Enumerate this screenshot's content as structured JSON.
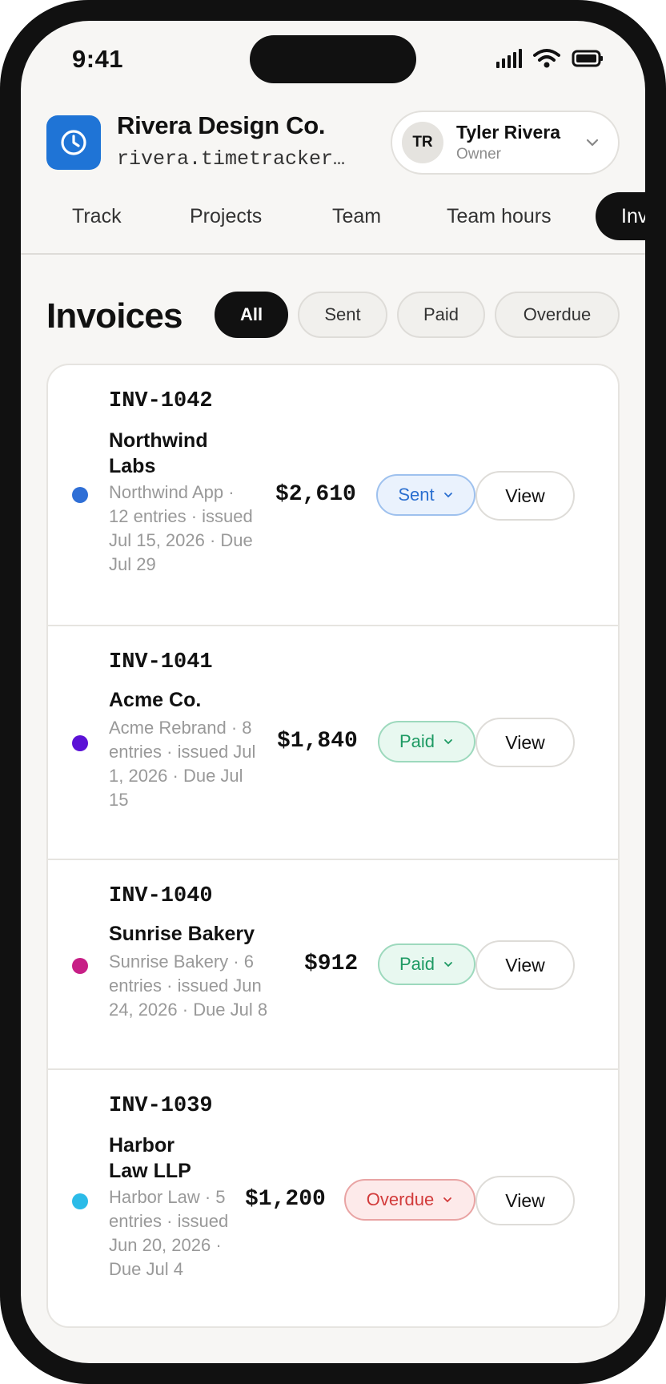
{
  "status_bar": {
    "time": "9:41"
  },
  "header": {
    "org_name": "Rivera Design Co.",
    "org_domain": "rivera.timetracker.app",
    "user": {
      "initials": "TR",
      "name": "Tyler Rivera",
      "role": "Owner"
    }
  },
  "tabs": [
    {
      "label": "Track",
      "active": false
    },
    {
      "label": "Projects",
      "active": false
    },
    {
      "label": "Team",
      "active": false
    },
    {
      "label": "Team hours",
      "active": false
    },
    {
      "label": "Invoices",
      "active": true
    }
  ],
  "page": {
    "title": "Invoices",
    "filters": [
      {
        "label": "All",
        "active": true
      },
      {
        "label": "Sent",
        "active": false
      },
      {
        "label": "Paid",
        "active": false
      },
      {
        "label": "Overdue",
        "active": false
      }
    ]
  },
  "invoices": [
    {
      "number": "INV-1042",
      "client": "Northwind Labs",
      "meta": "Northwind App · 12 entries · issued Jul 15, 2026 · Due Jul 29",
      "amount": "$2,610",
      "status": "Sent",
      "dot_color": "#2f6fd6",
      "action": "View"
    },
    {
      "number": "INV-1041",
      "client": "Acme Co.",
      "meta": "Acme Rebrand · 8 entries · issued Jul 1, 2026 · Due Jul 15",
      "amount": "$1,840",
      "status": "Paid",
      "dot_color": "#5b12d6",
      "action": "View"
    },
    {
      "number": "INV-1040",
      "client": "Sunrise Bakery",
      "meta": "Sunrise Bakery · 6 entries · issued Jun 24, 2026 · Due Jul 8",
      "amount": "$912",
      "status": "Paid",
      "dot_color": "#c71f86",
      "action": "View"
    },
    {
      "number": "INV-1039",
      "client": "Harbor Law LLP",
      "meta": "Harbor Law · 5 entries · issued Jun 20, 2026 · Due Jul 4",
      "amount": "$1,200",
      "status": "Overdue",
      "dot_color": "#2bbbe8",
      "action": "View"
    }
  ],
  "colors": {
    "accent": "#1f74d6",
    "sent": "#2a6fd0",
    "paid": "#1d9a63",
    "overdue": "#d23b3b"
  },
  "icons": [
    "clock-icon",
    "chevron-down-icon",
    "signal-icon",
    "wifi-icon",
    "battery-icon"
  ]
}
